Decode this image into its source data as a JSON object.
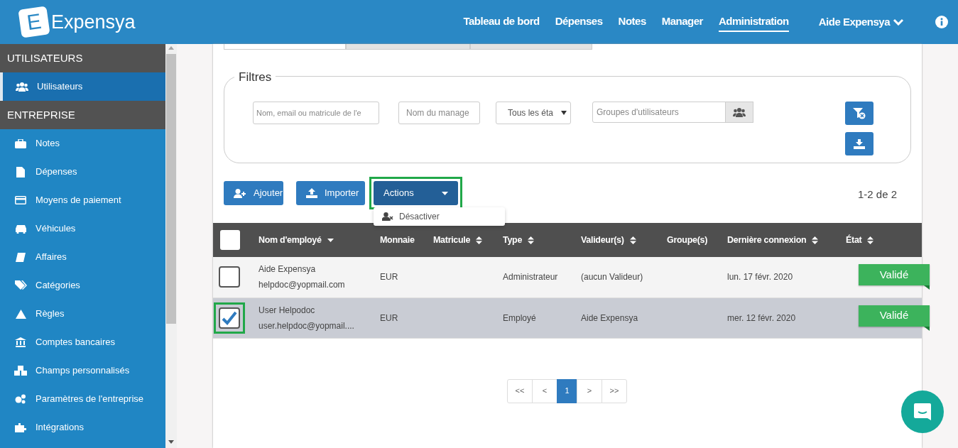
{
  "navbar": {
    "logo_letter": "E",
    "brand": "Expensya",
    "links": [
      {
        "label": "Tableau de bord",
        "selected": false
      },
      {
        "label": "Dépenses",
        "selected": false
      },
      {
        "label": "Notes",
        "selected": false
      },
      {
        "label": "Manager",
        "selected": false
      },
      {
        "label": "Administration",
        "selected": true
      }
    ],
    "user_menu": "Aide Expensya"
  },
  "sidebar": {
    "sections": [
      {
        "title": "UTILISATEURS",
        "items": [
          {
            "label": "Utilisateurs",
            "selected": true
          }
        ]
      },
      {
        "title": "ENTREPRISE",
        "items": [
          {
            "label": "Notes",
            "selected": false
          },
          {
            "label": "Dépenses",
            "selected": false
          },
          {
            "label": "Moyens de paiement",
            "selected": false
          },
          {
            "label": "Véhicules",
            "selected": false
          },
          {
            "label": "Affaires",
            "selected": false
          },
          {
            "label": "Catégories",
            "selected": false
          },
          {
            "label": "Règles",
            "selected": false
          },
          {
            "label": "Comptes bancaires",
            "selected": false
          },
          {
            "label": "Champs personnalisés",
            "selected": false
          },
          {
            "label": "Paramètres de l'entreprise",
            "selected": false
          },
          {
            "label": "Intégrations",
            "selected": false
          }
        ]
      }
    ]
  },
  "tabs": [
    {
      "selected": true
    },
    {
      "selected": false
    },
    {
      "selected": false
    }
  ],
  "filters": {
    "legend": "Filtres",
    "search": {
      "placeholder": "Nom, email ou matricule de l'e"
    },
    "manager": {
      "placeholder": "Nom du manage"
    },
    "state_select": {
      "value": "Tous les éta"
    },
    "groups": {
      "placeholder": "Groupes d'utilisateurs"
    }
  },
  "toolbar": {
    "buttons": [
      {
        "label": "Ajouter",
        "kind": "button",
        "highlighted": false
      },
      {
        "label": "Importer",
        "kind": "button",
        "highlighted": false
      },
      {
        "label": "Actions",
        "kind": "dropdown",
        "highlighted": true
      }
    ],
    "dropdown_items": [
      {
        "label": "Désactiver"
      }
    ],
    "count": "1-2 de 2"
  },
  "table": {
    "select_all_checked": false,
    "columns": [
      {
        "label": "Nom d'employé",
        "sortable": true,
        "selected": true
      },
      {
        "label": "Monnaie",
        "sortable": false,
        "selected": false
      },
      {
        "label": "Matricule",
        "sortable": true,
        "selected": false
      },
      {
        "label": "Type",
        "sortable": true,
        "selected": false
      },
      {
        "label": "Valideur(s)",
        "sortable": true,
        "selected": false
      },
      {
        "label": "Groupe(s)",
        "sortable": false,
        "selected": false
      },
      {
        "label": "Dernière connexion",
        "sortable": true,
        "selected": false
      },
      {
        "label": "État",
        "sortable": true,
        "selected": false
      }
    ],
    "rows": [
      {
        "checked": false,
        "selected": false,
        "highlighted": false,
        "name": "Aide Expensya",
        "email": "helpdoc@yopmail.com",
        "currency": "EUR",
        "type": "Administrateur",
        "validator": "(aucun Valideur)",
        "last_login": "lun. 17 févr. 2020",
        "status": "Validé"
      },
      {
        "checked": true,
        "selected": true,
        "highlighted": true,
        "name": "User Helpodoc",
        "email": "user.helpdoc@yopmail....",
        "currency": "EUR",
        "type": "Employé",
        "validator": "Aide Expensya",
        "last_login": "mer. 12 févr. 2020",
        "status": "Validé"
      }
    ]
  },
  "pagination": [
    {
      "label": "<<",
      "selected": false
    },
    {
      "label": "<",
      "selected": false
    },
    {
      "label": "1",
      "selected": true
    },
    {
      "label": ">",
      "selected": false
    },
    {
      "label": ">>",
      "selected": false
    }
  ]
}
